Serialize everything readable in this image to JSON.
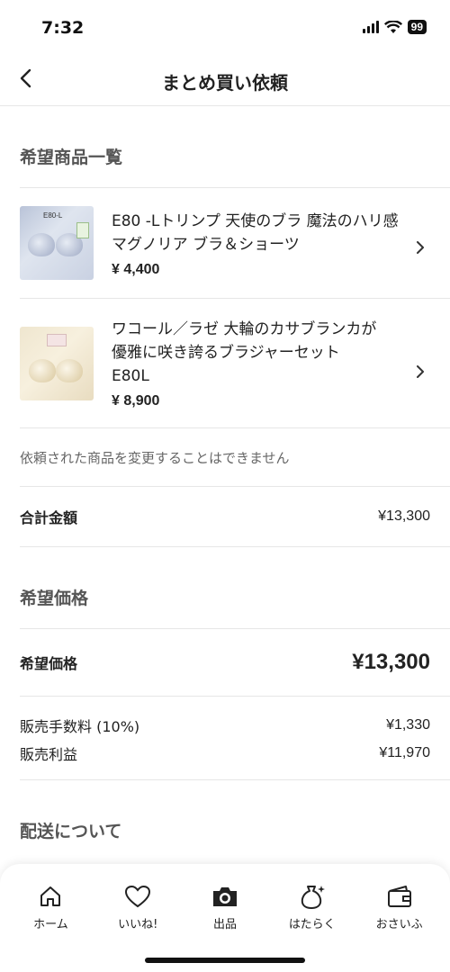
{
  "status": {
    "time": "7:32",
    "battery": "99"
  },
  "nav": {
    "title": "まとめ買い依頼"
  },
  "items_section": {
    "title": "希望商品一覧"
  },
  "items": [
    {
      "name": "E80 -Lトリンプ 天使のブラ 魔法のハリ感 マグノリア ブラ＆ショーツ",
      "price": "¥ 4,400",
      "thumb_text": "E80-L"
    },
    {
      "name": "ワコール／ラゼ 大輪のカサブランカが優雅に咲き誇るブラジャーセット E80L",
      "price": "¥ 8,900"
    }
  ],
  "notice": "依頼された商品を変更することはできません",
  "total": {
    "label": "合計金額",
    "value": "¥13,300"
  },
  "price_section": {
    "title": "希望価格"
  },
  "desired_price": {
    "label": "希望価格",
    "value": "¥13,300"
  },
  "fee": {
    "label": "販売手数料 (10%)",
    "value": "¥1,330"
  },
  "profit": {
    "label": "販売利益",
    "value": "¥11,970"
  },
  "shipping_section": {
    "title": "配送について"
  },
  "tabs": [
    {
      "label": "ホーム",
      "icon": "home-icon"
    },
    {
      "label": "いいね!",
      "icon": "heart-icon"
    },
    {
      "label": "出品",
      "icon": "camera-icon"
    },
    {
      "label": "はたらく",
      "icon": "money-bag-icon"
    },
    {
      "label": "おさいふ",
      "icon": "wallet-icon"
    }
  ]
}
